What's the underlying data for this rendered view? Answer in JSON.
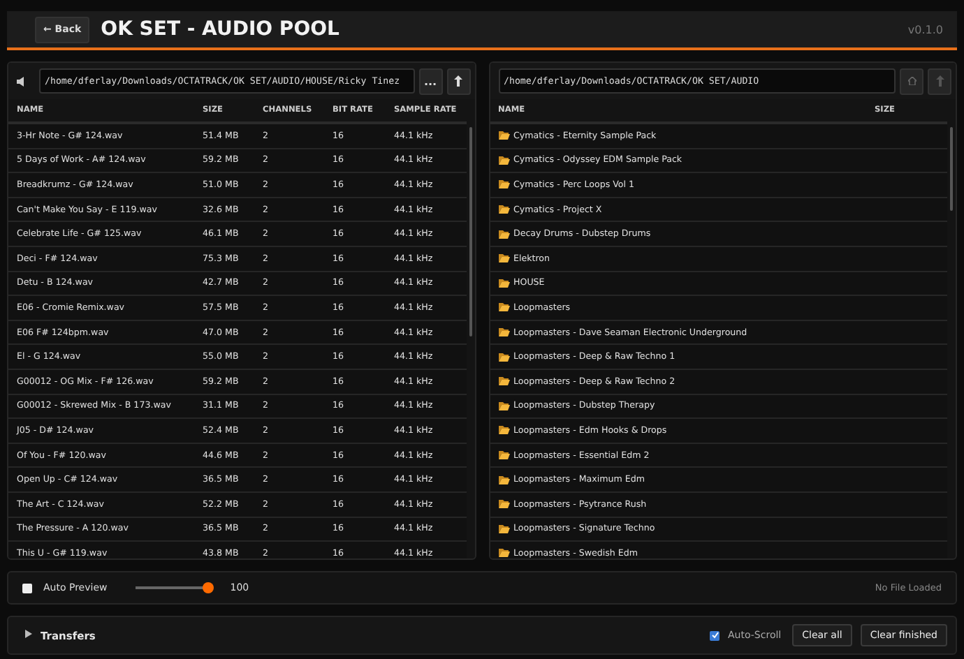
{
  "header": {
    "back_button": "← Back",
    "title": "OK SET - AUDIO POOL",
    "version": "v0.1.0"
  },
  "left_panel": {
    "path": "/home/dferlay/Downloads/OCTATRACK/OK SET/AUDIO/HOUSE/Ricky Tinez",
    "browse_button": "...",
    "columns": [
      "NAME",
      "SIZE",
      "CHANNELS",
      "BIT RATE",
      "SAMPLE RATE"
    ],
    "rows": [
      [
        "3-Hr Note - G# 124.wav",
        "51.4 MB",
        "2",
        "16",
        "44.1 kHz"
      ],
      [
        "5 Days of Work - A# 124.wav",
        "59.2 MB",
        "2",
        "16",
        "44.1 kHz"
      ],
      [
        "Breadkrumz - G# 124.wav",
        "51.0 MB",
        "2",
        "16",
        "44.1 kHz"
      ],
      [
        "Can't Make You Say - E 119.wav",
        "32.6 MB",
        "2",
        "16",
        "44.1 kHz"
      ],
      [
        "Celebrate Life - G# 125.wav",
        "46.1 MB",
        "2",
        "16",
        "44.1 kHz"
      ],
      [
        "Deci - F# 124.wav",
        "75.3 MB",
        "2",
        "16",
        "44.1 kHz"
      ],
      [
        "Detu - B 124.wav",
        "42.7 MB",
        "2",
        "16",
        "44.1 kHz"
      ],
      [
        "E06 - Cromie Remix.wav",
        "57.5 MB",
        "2",
        "16",
        "44.1 kHz"
      ],
      [
        "E06 F# 124bpm.wav",
        "47.0 MB",
        "2",
        "16",
        "44.1 kHz"
      ],
      [
        "El - G 124.wav",
        "55.0 MB",
        "2",
        "16",
        "44.1 kHz"
      ],
      [
        "G00012 - OG Mix - F# 126.wav",
        "59.2 MB",
        "2",
        "16",
        "44.1 kHz"
      ],
      [
        "G00012 - Skrewed Mix - B 173.wav",
        "31.1 MB",
        "2",
        "16",
        "44.1 kHz"
      ],
      [
        "J05 - D# 124.wav",
        "52.4 MB",
        "2",
        "16",
        "44.1 kHz"
      ],
      [
        "Of You - F# 120.wav",
        "44.6 MB",
        "2",
        "16",
        "44.1 kHz"
      ],
      [
        "Open Up - C# 124.wav",
        "36.5 MB",
        "2",
        "16",
        "44.1 kHz"
      ],
      [
        "The Art - C 124.wav",
        "52.2 MB",
        "2",
        "16",
        "44.1 kHz"
      ],
      [
        "The Pressure - A 120.wav",
        "36.5 MB",
        "2",
        "16",
        "44.1 kHz"
      ],
      [
        "This U - G# 119.wav",
        "43.8 MB",
        "2",
        "16",
        "44.1 kHz"
      ]
    ]
  },
  "right_panel": {
    "path": "/home/dferlay/Downloads/OCTATRACK/OK SET/AUDIO",
    "columns": [
      "NAME",
      "SIZE"
    ],
    "rows": [
      {
        "name": "Cymatics - Eternity Sample Pack",
        "kind": "folder"
      },
      {
        "name": "Cymatics - Odyssey EDM Sample Pack",
        "kind": "folder"
      },
      {
        "name": "Cymatics - Perc Loops Vol 1",
        "kind": "folder"
      },
      {
        "name": "Cymatics - Project X",
        "kind": "folder"
      },
      {
        "name": "Decay Drums - Dubstep Drums",
        "kind": "folder"
      },
      {
        "name": "Elektron",
        "kind": "folder"
      },
      {
        "name": "HOUSE",
        "kind": "folder"
      },
      {
        "name": "Loopmasters",
        "kind": "folder"
      },
      {
        "name": "Loopmasters - Dave Seaman Electronic Underground",
        "kind": "folder"
      },
      {
        "name": "Loopmasters - Deep & Raw Techno 1",
        "kind": "folder"
      },
      {
        "name": "Loopmasters - Deep & Raw Techno 2",
        "kind": "folder"
      },
      {
        "name": "Loopmasters - Dubstep Therapy",
        "kind": "folder"
      },
      {
        "name": "Loopmasters - Edm Hooks & Drops",
        "kind": "folder"
      },
      {
        "name": "Loopmasters - Essential Edm 2",
        "kind": "folder"
      },
      {
        "name": "Loopmasters - Maximum Edm",
        "kind": "folder"
      },
      {
        "name": "Loopmasters - Psytrance Rush",
        "kind": "folder"
      },
      {
        "name": "Loopmasters - Signature Techno",
        "kind": "folder"
      },
      {
        "name": "Loopmasters - Swedish Edm",
        "kind": "folder"
      }
    ]
  },
  "preview": {
    "auto_preview": {
      "label": "Auto Preview",
      "checked": false
    },
    "volume": {
      "level": 1,
      "reading": "100"
    },
    "status": "No File Loaded"
  },
  "transfers": {
    "title": "Transfers",
    "expanded": false,
    "auto_scroll": {
      "label": "Auto-Scroll",
      "checked": true
    },
    "buttons": [
      "Clear all",
      "Clear finished"
    ]
  }
}
